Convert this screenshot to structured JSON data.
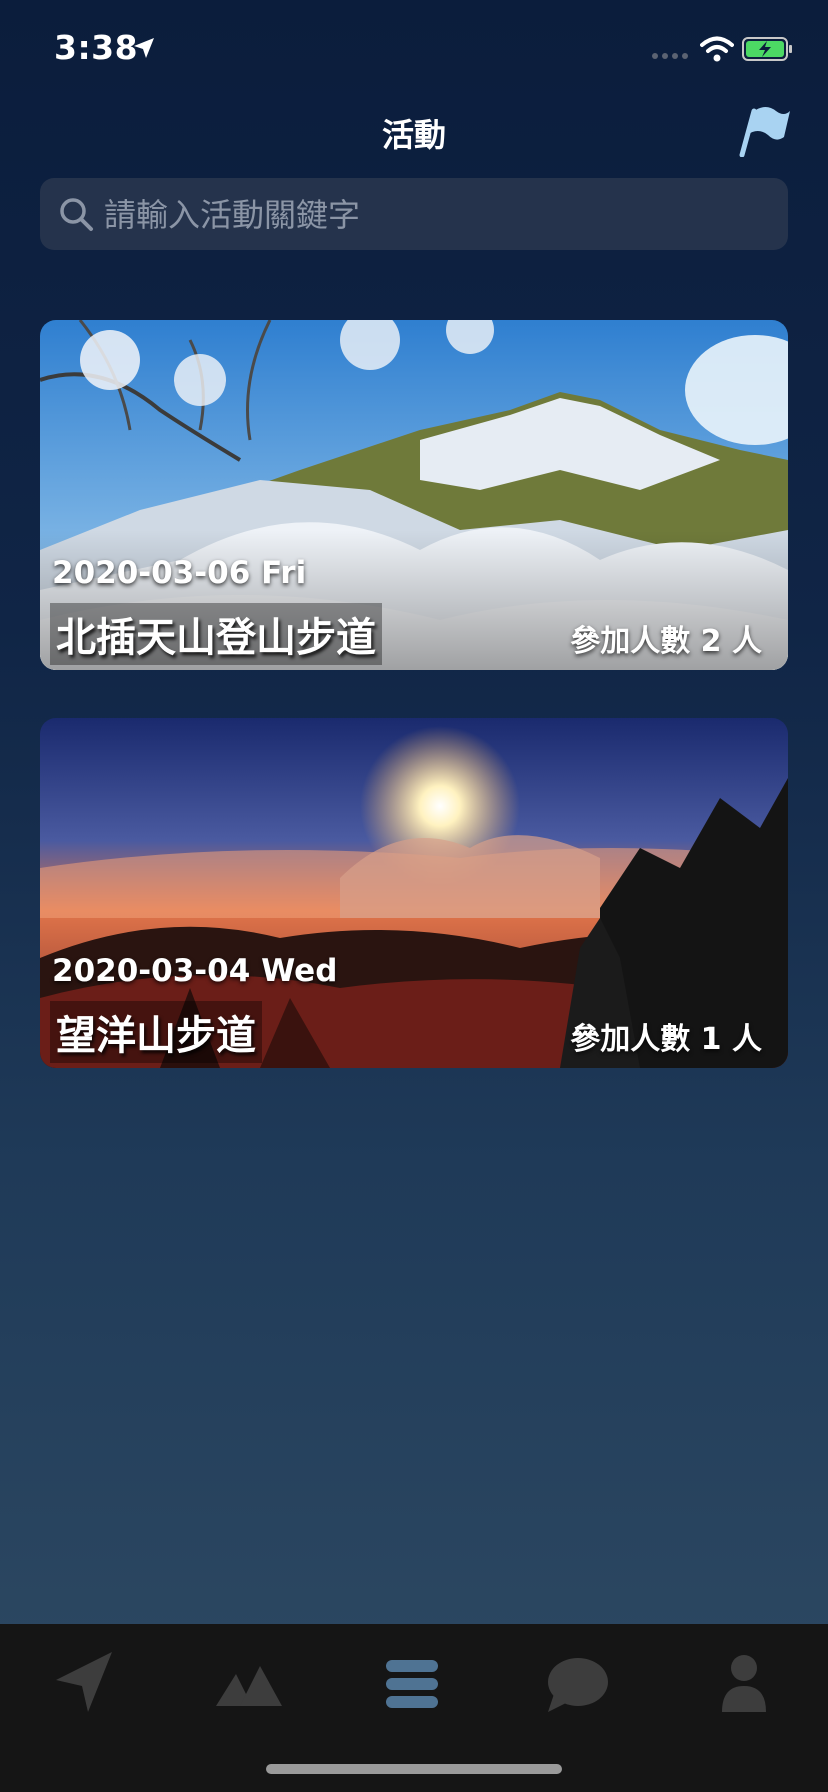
{
  "status_bar": {
    "time": "3:38",
    "icons": [
      "location-arrow-icon",
      "signal-icon",
      "wifi-icon",
      "battery-charging-icon"
    ]
  },
  "header": {
    "title": "活動",
    "action_icon": "flag-icon"
  },
  "search": {
    "placeholder": "請輸入活動關鍵字",
    "value": "",
    "icon": "search-icon"
  },
  "events": [
    {
      "date": "2020-03-06 Fri",
      "title": "北插天山登山步道",
      "participants": "參加人數 2 人",
      "image": "snowy-mountain-photo"
    },
    {
      "date": "2020-03-04 Wed",
      "title": "望洋山步道",
      "participants": "參加人數 1 人",
      "image": "sunrise-sea-of-clouds-photo"
    }
  ],
  "tab_bar": {
    "tabs": [
      {
        "name": "navigate",
        "icon": "navigation-arrow-icon",
        "active": false
      },
      {
        "name": "mountains",
        "icon": "mountains-icon",
        "active": false
      },
      {
        "name": "events",
        "icon": "list-icon",
        "active": true
      },
      {
        "name": "messages",
        "icon": "chat-bubble-icon",
        "active": false
      },
      {
        "name": "profile",
        "icon": "person-icon",
        "active": false
      }
    ]
  },
  "colors": {
    "background_top": "#0b1d3c",
    "background_bottom": "#2f4b64",
    "search_field": "#25334c",
    "flag_accent": "#a9d3f2",
    "tab_active": "#4f7393",
    "tab_inactive": "#3d3d3d",
    "tab_bar": "#151515",
    "battery_green": "#4cd964"
  }
}
